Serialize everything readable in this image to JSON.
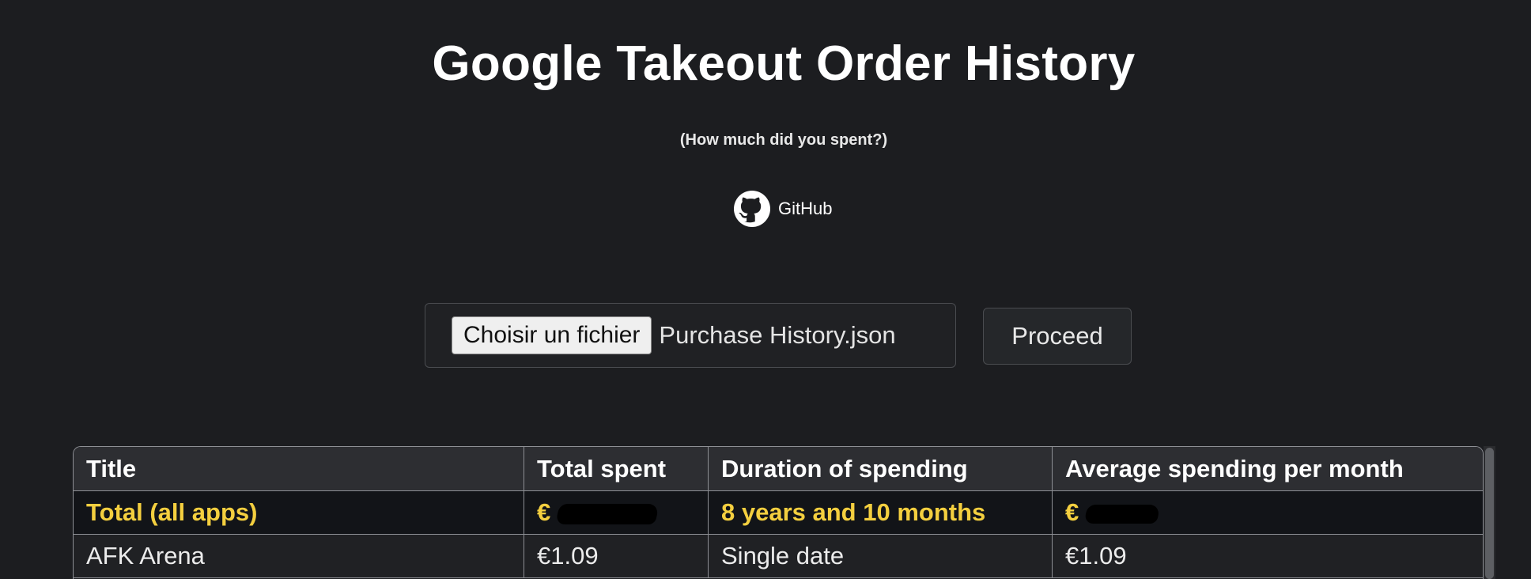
{
  "header": {
    "title": "Google Takeout Order History",
    "subtitle": "(How much did you spent?)",
    "github_label": "GitHub",
    "github_icon": "github-icon"
  },
  "upload": {
    "file_button_label": "Choisir un fichier",
    "file_name": "Purchase History.json",
    "proceed_label": "Proceed"
  },
  "table": {
    "columns": [
      "Title",
      "Total spent",
      "Duration of spending",
      "Average spending per month"
    ],
    "total_row": {
      "title": "Total (all apps)",
      "total_spent": "€",
      "duration": "8 years and 10 months",
      "average": "€"
    },
    "rows": [
      {
        "title": "AFK Arena",
        "total_spent": "€1.09",
        "duration": "Single date",
        "average": "€1.09"
      }
    ]
  },
  "colors": {
    "background": "#1c1d20",
    "total_accent": "#f4cf3f",
    "border": "#8d8f94"
  }
}
